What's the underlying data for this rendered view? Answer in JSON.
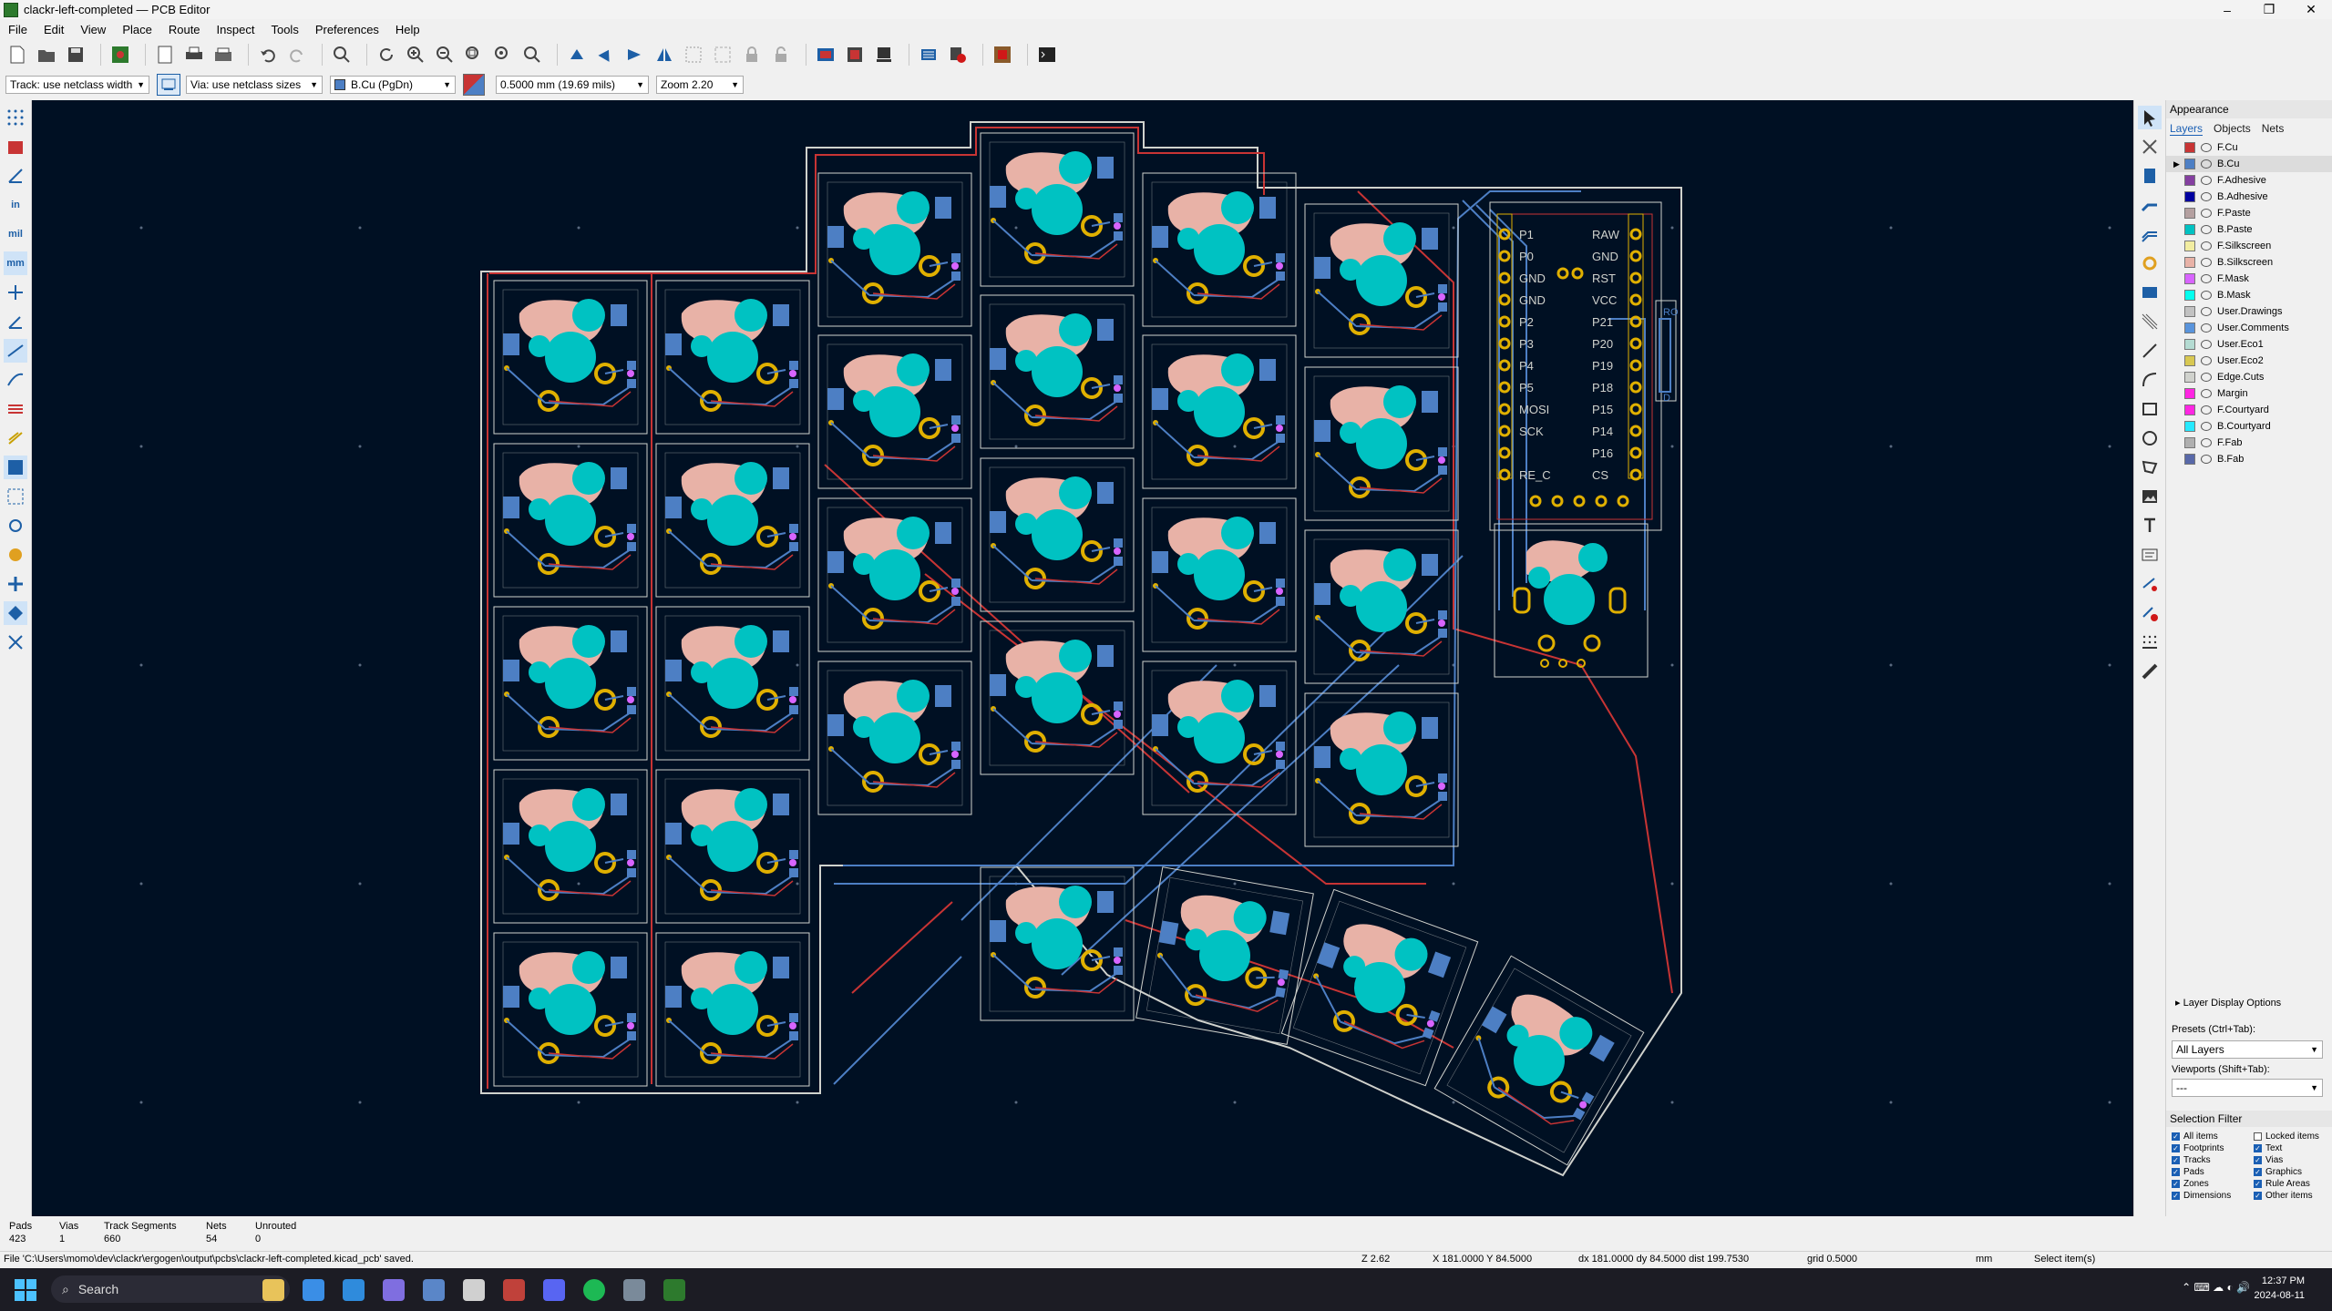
{
  "window": {
    "title": "clackr-left-completed — PCB Editor",
    "minimize": "–",
    "maximize": "❐",
    "close": "✕"
  },
  "menu": [
    "File",
    "Edit",
    "View",
    "Place",
    "Route",
    "Inspect",
    "Tools",
    "Preferences",
    "Help"
  ],
  "options": {
    "track_width": "Track: use netclass width",
    "via_size": "Via: use netclass sizes",
    "layer": "B.Cu (PgDn)",
    "grid": "0.5000 mm (19.69 mils)",
    "zoom": "Zoom 2.20"
  },
  "left_toolbar": {
    "units_in": "in",
    "units_mil": "mil",
    "units_mm": "mm"
  },
  "appearance": {
    "title": "Appearance",
    "tabs": [
      "Layers",
      "Objects",
      "Nets"
    ],
    "layers": [
      {
        "name": "F.Cu",
        "color": "#c83434"
      },
      {
        "name": "B.Cu",
        "color": "#4d7fc4"
      },
      {
        "name": "F.Adhesive",
        "color": "#843fa0"
      },
      {
        "name": "B.Adhesive",
        "color": "#0000a0"
      },
      {
        "name": "F.Paste",
        "color": "#b4a0a0"
      },
      {
        "name": "B.Paste",
        "color": "#00c2c2"
      },
      {
        "name": "F.Silkscreen",
        "color": "#f2eda1"
      },
      {
        "name": "B.Silkscreen",
        "color": "#e8b2a7"
      },
      {
        "name": "F.Mask",
        "color": "#d864ff"
      },
      {
        "name": "B.Mask",
        "color": "#02ffee"
      },
      {
        "name": "User.Drawings",
        "color": "#c2c2c2"
      },
      {
        "name": "User.Comments",
        "color": "#5994dc"
      },
      {
        "name": "User.Eco1",
        "color": "#b4dbd2"
      },
      {
        "name": "User.Eco2",
        "color": "#d8c852"
      },
      {
        "name": "Edge.Cuts",
        "color": "#d0d2cd"
      },
      {
        "name": "Margin",
        "color": "#ff26e2"
      },
      {
        "name": "F.Courtyard",
        "color": "#ff26e2"
      },
      {
        "name": "B.Courtyard",
        "color": "#26e9ff"
      },
      {
        "name": "F.Fab",
        "color": "#afafaf"
      },
      {
        "name": "B.Fab",
        "color": "#5868a8"
      }
    ],
    "layer_display_options": "Layer Display Options",
    "presets_label": "Presets (Ctrl+Tab):",
    "presets_value": "All Layers",
    "viewports_label": "Viewports (Shift+Tab):",
    "viewports_value": "---",
    "selection_filter_title": "Selection Filter",
    "selection_filter": [
      {
        "label": "All items",
        "checked": true
      },
      {
        "label": "Locked items",
        "checked": false
      },
      {
        "label": "Footprints",
        "checked": true
      },
      {
        "label": "Text",
        "checked": true
      },
      {
        "label": "Tracks",
        "checked": true
      },
      {
        "label": "Vias",
        "checked": true
      },
      {
        "label": "Pads",
        "checked": true
      },
      {
        "label": "Graphics",
        "checked": true
      },
      {
        "label": "Zones",
        "checked": true
      },
      {
        "label": "Rule Areas",
        "checked": true
      },
      {
        "label": "Dimensions",
        "checked": true
      },
      {
        "label": "Other items",
        "checked": true
      }
    ]
  },
  "pcb": {
    "mcu_left_labels": [
      "P1",
      "P0",
      "GND",
      "GND",
      "P2",
      "P3",
      "P4",
      "P5",
      "MOSI",
      "SCK",
      "RE_C"
    ],
    "mcu_right_labels": [
      "RAW",
      "GND",
      "RST",
      "VCC",
      "P21",
      "P20",
      "P19",
      "P18",
      "P15",
      "P14",
      "P16",
      "CS"
    ],
    "side_labels": [
      "RO",
      "D"
    ],
    "colors": {
      "board_bg": "#001023",
      "edge": "#d0d2cd",
      "fcu": "#c83434",
      "bcu": "#4d7fc4",
      "pad": "#00c2c2",
      "silk": "#e8b2a7",
      "gold": "#c8a000"
    }
  },
  "messages": {
    "pads_label": "Pads",
    "pads_value": "423",
    "vias_label": "Vias",
    "vias_value": "1",
    "tracks_label": "Track Segments",
    "tracks_value": "660",
    "nets_label": "Nets",
    "nets_value": "54",
    "unrouted_label": "Unrouted",
    "unrouted_value": "0"
  },
  "status": {
    "file_msg": "File 'C:\\Users\\momo\\dev\\clackr\\ergogen\\output\\pcbs\\clackr-left-completed.kicad_pcb' saved.",
    "zoom": "Z 2.62",
    "xy": "X 181.0000  Y 84.5000",
    "dxy": "dx 181.0000  dy 84.5000  dist 199.7530",
    "grid": "grid 0.5000",
    "units": "mm",
    "mode": "Select item(s)"
  },
  "taskbar": {
    "search": "Search",
    "time": "12:37 PM",
    "date": "2024-08-11"
  }
}
